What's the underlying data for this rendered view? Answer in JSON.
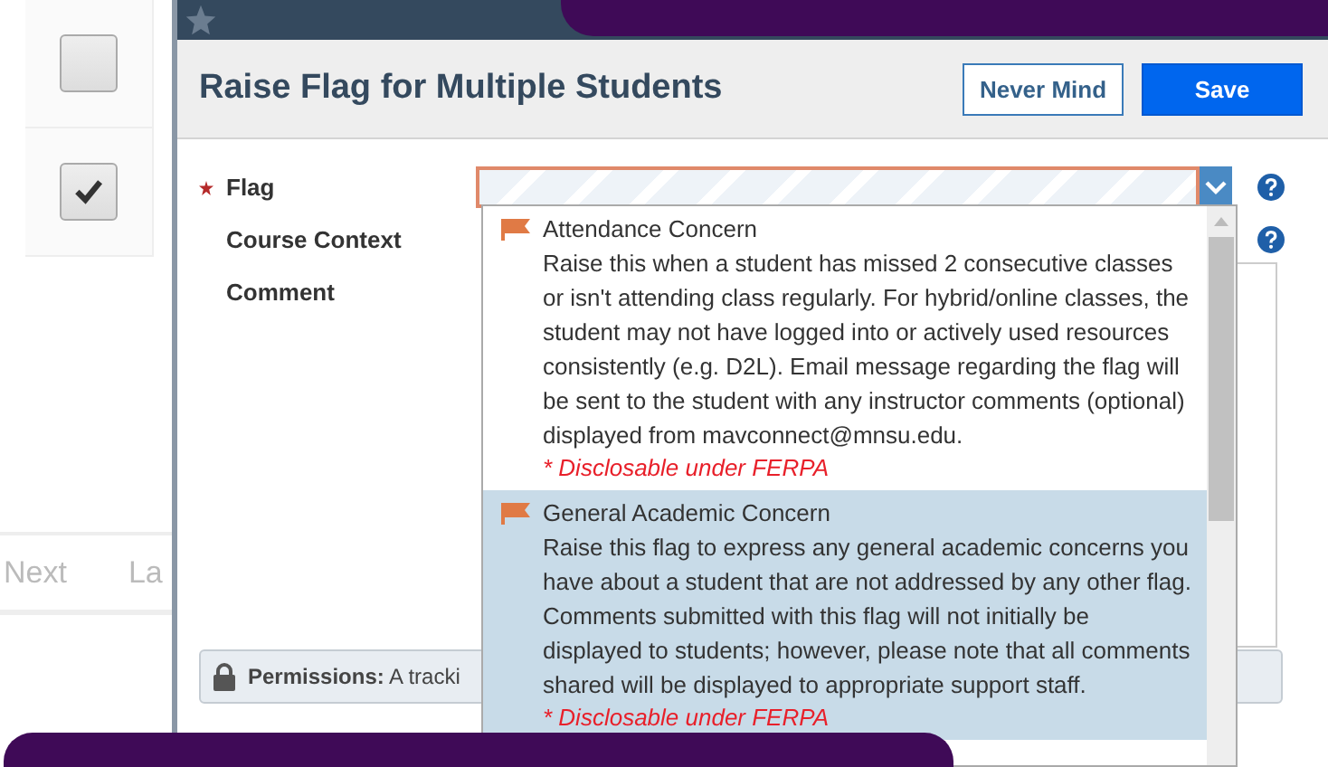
{
  "background_page": {
    "checkboxes": [
      {
        "checked": false
      },
      {
        "checked": true
      }
    ],
    "pagination": [
      "Next",
      "La"
    ]
  },
  "dialog": {
    "title": "Raise Flag for Multiple Students",
    "buttons": [
      {
        "label": "Never Mind",
        "kind": "secondary"
      },
      {
        "label": "Save",
        "kind": "primary"
      }
    ],
    "fields": [
      {
        "label": "Flag",
        "required": true,
        "help": true
      },
      {
        "label": "Course Context",
        "required": false,
        "help": true
      },
      {
        "label": "Comment",
        "required": false,
        "help": false
      }
    ],
    "flag_options": [
      {
        "title": "Attendance Concern",
        "description": "Raise this when a student has missed 2 consecutive classes or isn't attending class regularly. For hybrid/online classes, the student may not have logged into or actively used resources consistently (e.g. D2L). Email message regarding the flag will be sent to the student with any instructor comments (optional) displayed from mavconnect@mnsu.edu.",
        "note": "* Disclosable under FERPA",
        "selected": false
      },
      {
        "title": "General Academic Concern",
        "description": "Raise this flag to express any general academic concerns you have about a student that are not addressed by any other flag. Comments submitted with this flag will not initially be displayed to students; however, please note that all comments shared will be displayed to appropriate support staff.",
        "note": "* Disclosable under FERPA",
        "selected": true
      }
    ],
    "permissions": "**Permissions:** A tracki"
  }
}
